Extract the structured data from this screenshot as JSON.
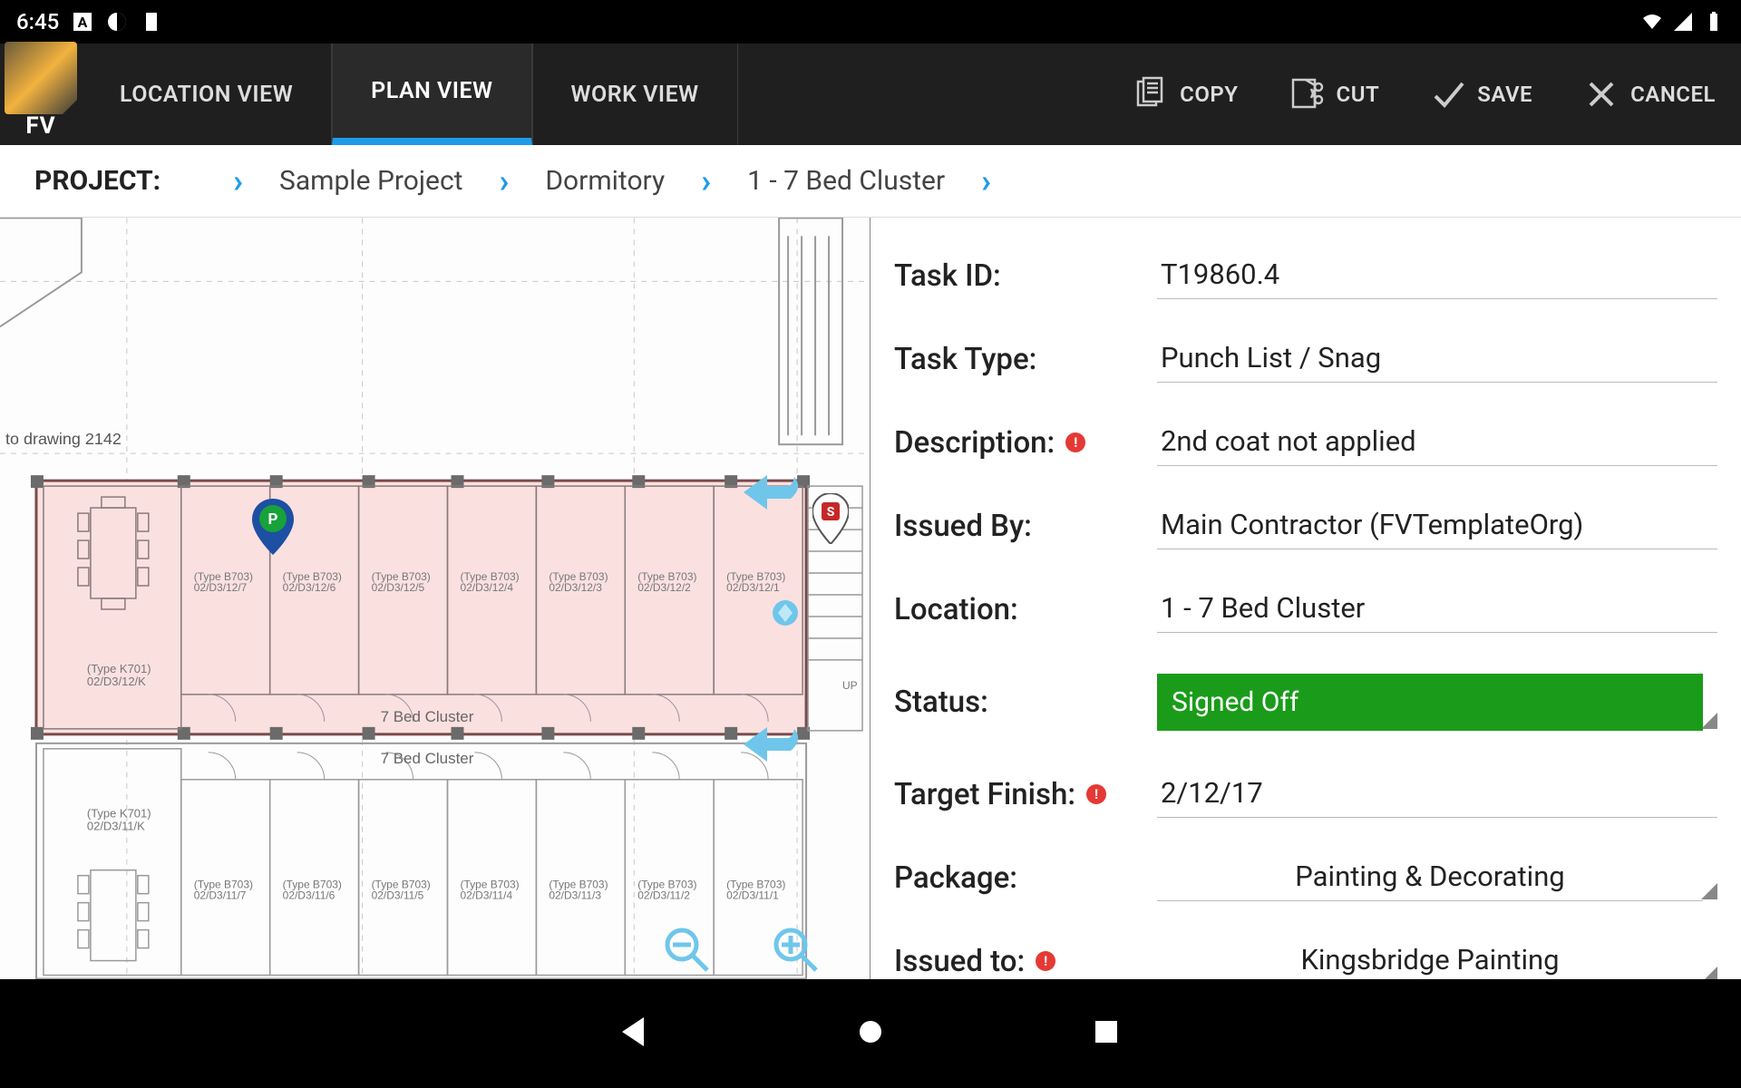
{
  "status_bar": {
    "time": "6:45"
  },
  "toolbar": {
    "logo_text": "FV",
    "tabs": {
      "location": "LOCATION VIEW",
      "plan": "PLAN VIEW",
      "work": "WORK VIEW"
    },
    "actions": {
      "copy": "COPY",
      "cut": "CUT",
      "save": "SAVE",
      "cancel": "CANCEL"
    }
  },
  "breadcrumb": {
    "label": "PROJECT:",
    "items": [
      "Sample Project",
      "Dormitory",
      "1 - 7 Bed Cluster"
    ]
  },
  "plan": {
    "note_text": "to drawing 2142",
    "cluster_label_1": "7 Bed Cluster",
    "cluster_label_2": "7 Bed Cluster",
    "room_type_k": "(Type K701)",
    "room_ref_k_top": "02/D3/12/K",
    "room_ref_k_bot": "02/D3/11/K",
    "room_type_b": "(Type B703)",
    "up_label": "UP",
    "pin_p": "P",
    "pin_s": "S",
    "top_refs": [
      "02/D3/12/7",
      "02/D3/12/6",
      "02/D3/12/5",
      "02/D3/12/4",
      "02/D3/12/3",
      "02/D3/12/2",
      "02/D3/12/1"
    ],
    "bot_refs": [
      "02/D3/11/7",
      "02/D3/11/6",
      "02/D3/11/5",
      "02/D3/11/4",
      "02/D3/11/3",
      "02/D3/11/2",
      "02/D3/11/1"
    ]
  },
  "form": {
    "task_id": {
      "label": "Task ID:",
      "value": "T19860.4"
    },
    "task_type": {
      "label": "Task Type:",
      "value": "Punch List / Snag"
    },
    "description": {
      "label": "Description:",
      "value": "2nd coat not applied"
    },
    "issued_by": {
      "label": "Issued By:",
      "value": "Main Contractor (FVTemplateOrg)"
    },
    "location": {
      "label": "Location:",
      "value": "1 - 7 Bed Cluster"
    },
    "status": {
      "label": "Status:",
      "value": "Signed Off",
      "color": "#1a9c1a"
    },
    "target_finish": {
      "label": "Target Finish:",
      "value": "2/12/17"
    },
    "package": {
      "label": "Package:",
      "value": "Painting & Decorating"
    },
    "issued_to": {
      "label": "Issued to:",
      "value": "Kingsbridge Painting"
    }
  }
}
